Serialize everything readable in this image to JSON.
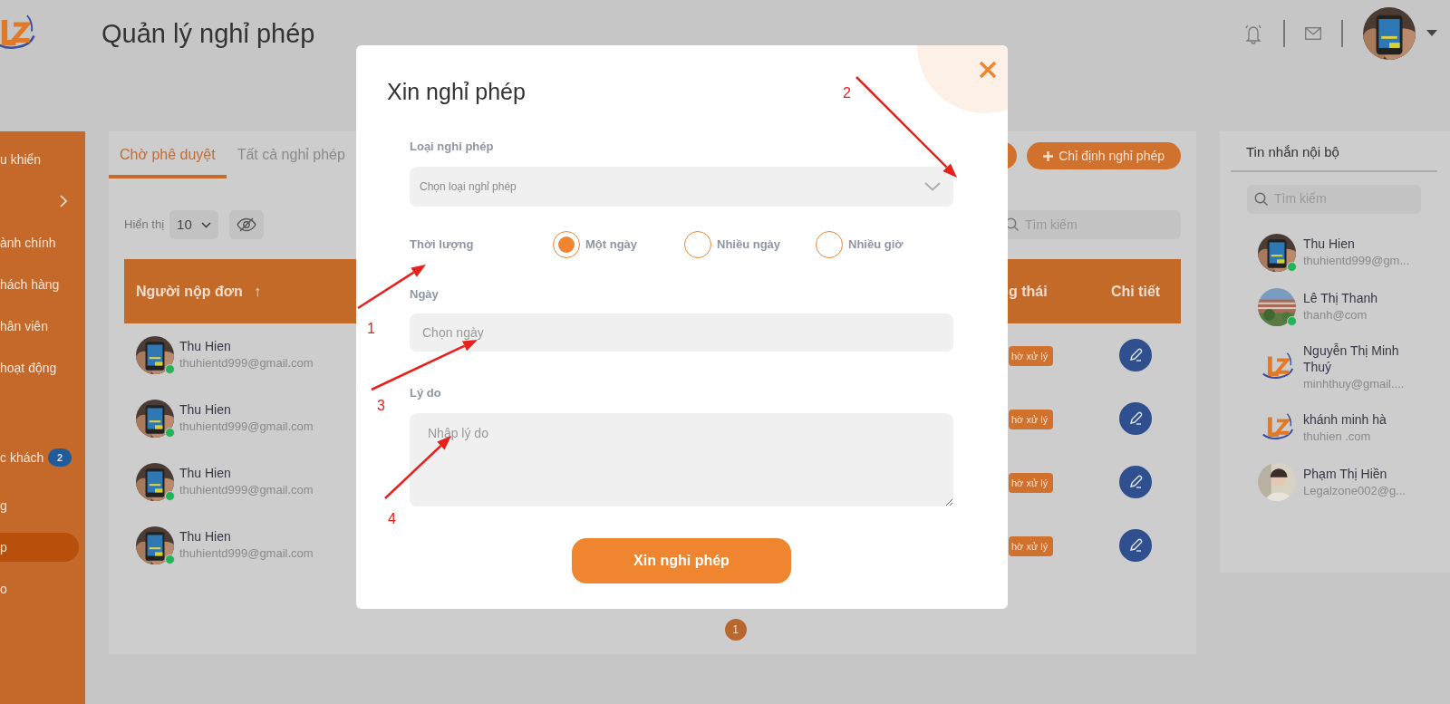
{
  "header": {
    "title": "Quản lý nghỉ phép"
  },
  "sidebar": {
    "items": [
      {
        "label": "u khiển",
        "has_submenu": false,
        "selected": false
      },
      {
        "has_submenu": true,
        "selected": false
      },
      {
        "label": "ành chính",
        "has_submenu": false,
        "selected": false
      },
      {
        "label": "hách hàng",
        "has_submenu": false,
        "selected": false
      },
      {
        "label": "hân viên",
        "has_submenu": false,
        "selected": false
      },
      {
        "label": "hoạt động",
        "has_submenu": false,
        "selected": false
      },
      {
        "label": "c khách",
        "badge": "2",
        "has_submenu": false,
        "selected": false
      },
      {
        "label": "g",
        "has_submenu": false,
        "selected": false
      },
      {
        "label": "p",
        "has_submenu": false,
        "selected": true
      },
      {
        "label": "o",
        "has_submenu": false,
        "selected": false
      }
    ]
  },
  "tabs": [
    {
      "label": "Chờ phê duyệt",
      "selected": true
    },
    {
      "label": "Tất cả nghỉ phép",
      "selected": false
    }
  ],
  "toolbar": {
    "show_label": "Hiển thị",
    "page_size": "10",
    "assign_button": "Chỉ định nghỉ phép",
    "search_placeholder": "Tìm kiếm"
  },
  "table": {
    "columns": [
      "Người nộp đơn",
      "g thái",
      "Chi tiết"
    ],
    "sort_mark": "↑",
    "rows": [
      {
        "name": "Thu Hien",
        "email": "thuhientd999@gmail.com",
        "online": true,
        "status": "hờ xử lý"
      },
      {
        "name": "Thu Hien",
        "email": "thuhientd999@gmail.com",
        "online": true,
        "status": "hờ xử lý"
      },
      {
        "name": "Thu Hien",
        "email": "thuhientd999@gmail.com",
        "online": true,
        "status": "hờ xử lý"
      },
      {
        "name": "Thu Hien",
        "email": "thuhientd999@gmail.com",
        "online": true,
        "status": "hờ xử lý"
      }
    ]
  },
  "pagination": [
    {
      "label": "1",
      "selected": true
    }
  ],
  "chat": {
    "title": "Tin nhắn nội bộ",
    "search_placeholder": "Tìm kiếm",
    "contacts": [
      {
        "name": "Thu Hien",
        "email": "thuhientd999@gm...",
        "online": true,
        "kind": "phone"
      },
      {
        "name": "Lê Thị Thanh",
        "email": "thanh@com",
        "online": true,
        "kind": "building"
      },
      {
        "name": "Nguyễn Thị Minh Thuý",
        "email": "minhthuy@gmail....",
        "online": false,
        "kind": "logo"
      },
      {
        "name": "khánh minh hà",
        "email": "thuhien .com",
        "online": false,
        "kind": "logo"
      },
      {
        "name": "Phạm Thị Hiền",
        "email": "Legalzone002@g...",
        "online": false,
        "kind": "person"
      }
    ]
  },
  "modal": {
    "title": "Xin nghỉ phép",
    "leave_type": {
      "label": "Loại nghỉ phép",
      "placeholder": "Chọn loại nghỉ phép"
    },
    "duration": {
      "label": "Thời lượng",
      "options": [
        {
          "label": "Một ngày",
          "selected": true
        },
        {
          "label": "Nhiều ngày",
          "selected": false
        },
        {
          "label": "Nhiều giờ",
          "selected": false
        }
      ]
    },
    "date": {
      "label": "Ngày",
      "placeholder": "Chọn ngày"
    },
    "reason": {
      "label": "Lý do",
      "placeholder": "Nhập lý do"
    },
    "submit": "Xin nghỉ phép"
  },
  "annotations": [
    {
      "label": "1"
    },
    {
      "label": "2"
    },
    {
      "label": "3"
    },
    {
      "label": "4"
    }
  ]
}
